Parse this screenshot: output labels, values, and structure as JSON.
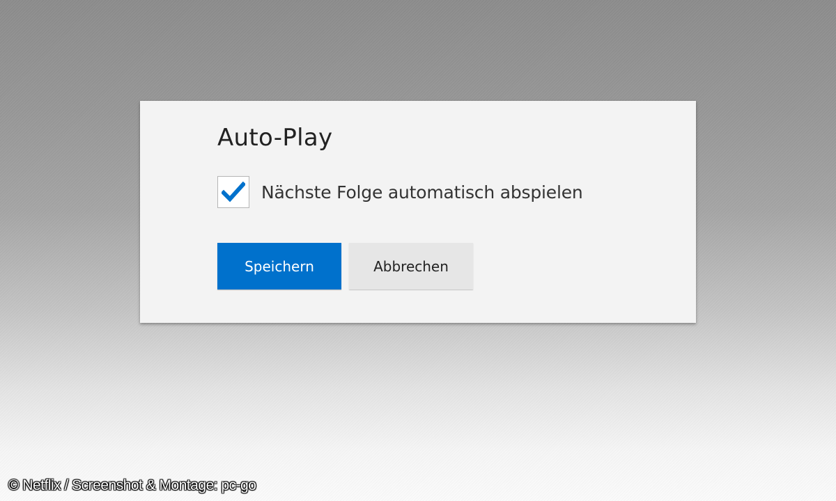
{
  "dialog": {
    "title": "Auto-Play",
    "option": {
      "label": "Nächste Folge automatisch abspielen",
      "checked": true,
      "icon": "checkmark-icon"
    },
    "buttons": {
      "save_label": "Speichern",
      "cancel_label": "Abbrechen"
    }
  },
  "watermark": "© Netflix / Screenshot & Montage: pc-go",
  "colors": {
    "accent": "#0071cc",
    "checkmark": "#0071cc",
    "dialog_bg": "#f3f3f3",
    "cancel_bg": "#e6e6e6"
  }
}
